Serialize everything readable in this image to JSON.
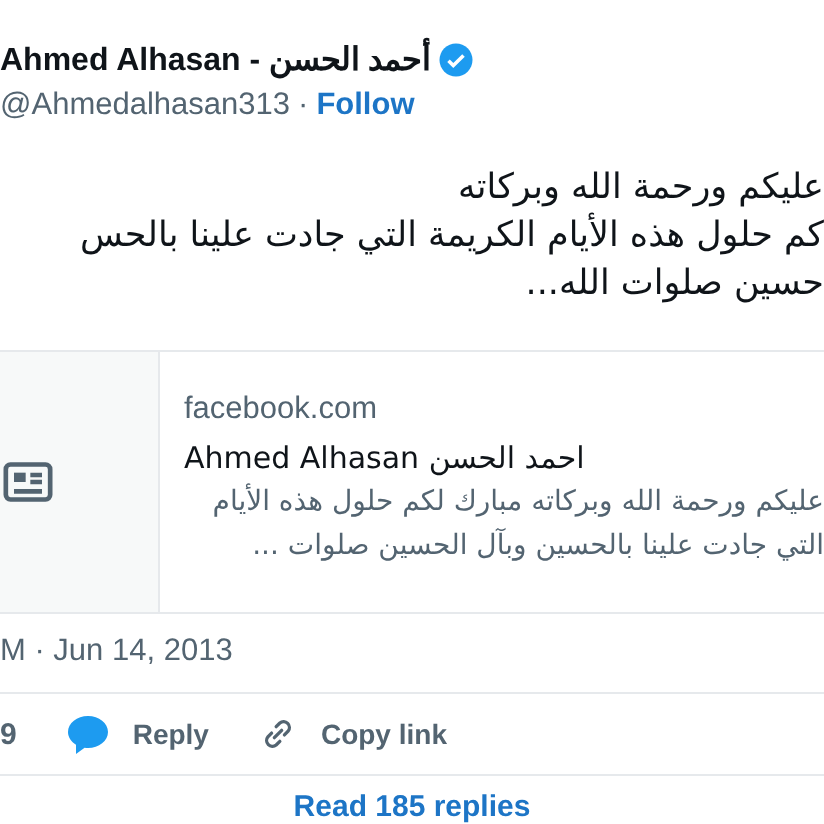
{
  "author": {
    "name": "Ahmed Alhasan - أحمد الحسن",
    "verified": true,
    "handle": "@Ahmedalhasan313",
    "separator": "·",
    "follow": "Follow"
  },
  "tweet_text": [
    "عليكم ورحمة الله وبركاته",
    "كم حلول هذه الأيام الكريمة التي جادت علينا بالحس",
    "حسين صلوات الله..."
  ],
  "link_card": {
    "domain": "facebook.com",
    "title": "Ahmed Alhasan احمد الحسن",
    "description": [
      "عليكم ورحمة الله وبركاته مبارك لكم حلول هذه الأيام",
      "التي جادت علينا بالحسين وبآل الحسين صلوات ..."
    ]
  },
  "timestamp": "M · Jun 14, 2013",
  "like_count": "9",
  "reply": "Reply",
  "copy_link": "Copy link",
  "read_replies": "Read 185 replies"
}
